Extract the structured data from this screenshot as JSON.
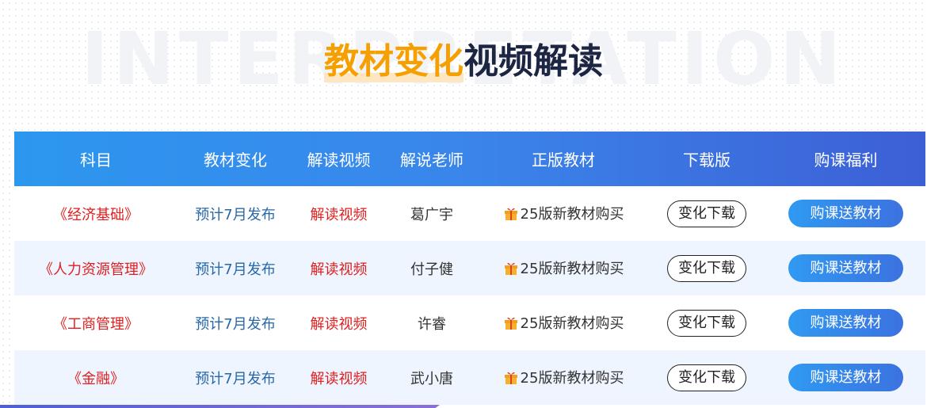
{
  "watermark": "INTERPRETATION",
  "title": {
    "highlight": "教材变化",
    "rest": "视频解读"
  },
  "table": {
    "headers": [
      "科目",
      "教材变化",
      "解读视频",
      "解说老师",
      "正版教材",
      "下载版",
      "购课福利"
    ],
    "rows": [
      {
        "subject": "《经济基础》",
        "release": "预计7月发布",
        "video": "解读视频",
        "teacher": "葛广宇",
        "textbook": "25版新教材购买",
        "download": "变化下载",
        "buy": "购课送教材"
      },
      {
        "subject": "《人力资源管理》",
        "release": "预计7月发布",
        "video": "解读视频",
        "teacher": "付子健",
        "textbook": "25版新教材购买",
        "download": "变化下载",
        "buy": "购课送教材"
      },
      {
        "subject": "《工商管理》",
        "release": "预计7月发布",
        "video": "解读视频",
        "teacher": "许睿",
        "textbook": "25版新教材购买",
        "download": "变化下载",
        "buy": "购课送教材"
      },
      {
        "subject": "《金融》",
        "release": "预计7月发布",
        "video": "解读视频",
        "teacher": "武小唐",
        "textbook": "25版新教材购买",
        "download": "变化下载",
        "buy": "购课送教材"
      }
    ]
  },
  "icons": {
    "textbook": "gift-icon"
  },
  "colors": {
    "title_highlight": "#f5a000",
    "title_dark": "#1c2541",
    "header_start": "#2c97ef",
    "header_end": "#3d5fd6",
    "subject_red": "#e02020",
    "release_blue": "#2868a8",
    "row_alt": "#eef5fe"
  }
}
